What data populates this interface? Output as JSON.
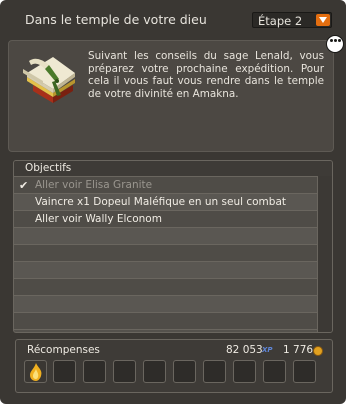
{
  "window": {
    "title": "Dans le temple de votre dieu",
    "step_select": "Étape 2"
  },
  "quest": {
    "icon": "scroll-bundle-icon",
    "description": "Suivant les conseils du sage Lenald, vous préparez votre prochaine expédition. Pour cela il vous faut vous rendre dans le temple de votre divinité en Amakna."
  },
  "objectives": {
    "header": "Objectifs",
    "items": [
      {
        "label": "Aller voir Elisa Granite",
        "done": true
      },
      {
        "label": "Vaincre x1 Dopeul Maléfique en un seul combat",
        "done": false
      },
      {
        "label": "Aller voir Wally Elconom",
        "done": false
      }
    ]
  },
  "rewards": {
    "label": "Récompenses",
    "xp": "82 053",
    "xp_unit": "XP",
    "kamas": "1 776",
    "slots": 10,
    "first_slot_icon": "flame-icon"
  },
  "colors": {
    "accent": "#e46e10",
    "panel": "#3a3733"
  }
}
